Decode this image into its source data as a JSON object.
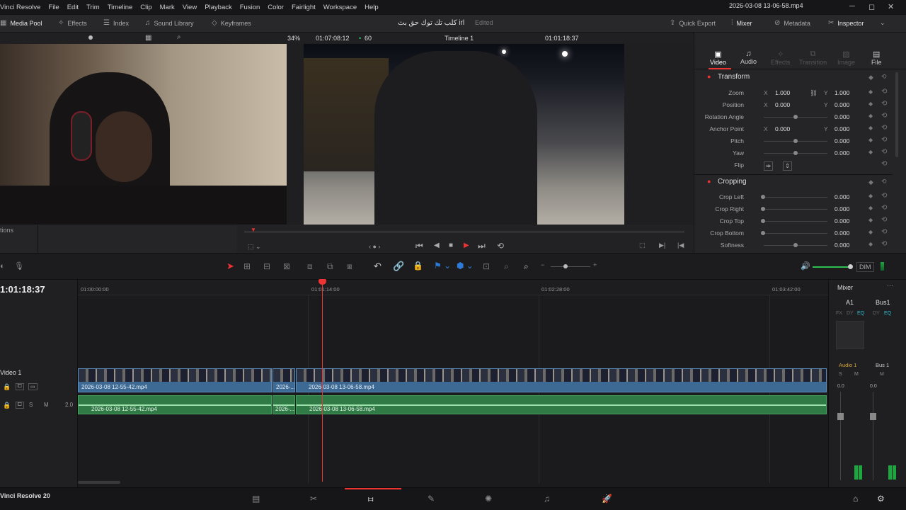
{
  "menu": {
    "app": "Vinci Resolve",
    "items": [
      "File",
      "Edit",
      "Trim",
      "Timeline",
      "Clip",
      "Mark",
      "View",
      "Playback",
      "Fusion",
      "Color",
      "Fairlight",
      "Workspace",
      "Help"
    ]
  },
  "toolbar": {
    "media_pool": "Media Pool",
    "effects": "Effects",
    "index": "Index",
    "sound_library": "Sound Library",
    "keyframes": "Keyframes",
    "project_title": "كلب تك توك حق بث irl",
    "edited": "Edited",
    "quick_export": "Quick Export",
    "mixer": "Mixer",
    "metadata": "Metadata",
    "inspector": "Inspector"
  },
  "viewer": {
    "zoom": "34%",
    "source_tc": "01:07:08:12",
    "fps": "60",
    "timeline_name": "Timeline 1",
    "record_tc": "01:01:18:37",
    "clip_name": "2026-03-08 13-06-58.mp4"
  },
  "left_panel": {
    "label": "tions"
  },
  "inspector": {
    "tabs": [
      "Video",
      "Audio",
      "Effects",
      "Transition",
      "Image",
      "File"
    ],
    "transform_title": "Transform",
    "cropping_title": "Cropping",
    "transform": [
      {
        "label": "Zoom",
        "x": "1.000",
        "y": "1.000"
      },
      {
        "label": "Position",
        "x": "0.000",
        "y": "0.000"
      },
      {
        "label": "Rotation Angle",
        "v": "0.000"
      },
      {
        "label": "Anchor Point",
        "x": "0.000",
        "y": "0.000"
      },
      {
        "label": "Pitch",
        "v": "0.000"
      },
      {
        "label": "Yaw",
        "v": "0.000"
      },
      {
        "label": "Flip"
      }
    ],
    "cropping": [
      {
        "label": "Crop Left",
        "v": "0.000"
      },
      {
        "label": "Crop Right",
        "v": "0.000"
      },
      {
        "label": "Crop Top",
        "v": "0.000"
      },
      {
        "label": "Crop Bottom",
        "v": "0.000"
      },
      {
        "label": "Softness",
        "v": "0.000"
      }
    ],
    "axis_x": "X",
    "axis_y": "Y"
  },
  "edit_toolbar": {
    "dim": "DIM"
  },
  "timeline": {
    "current_tc": "1:01:18:37",
    "ruler": [
      "01:00:00:00",
      "01:01:14:00",
      "01:02:28:00",
      "01:03:42:00"
    ],
    "video_track": "Video 1",
    "audio_level": "2.0",
    "clips_video": [
      "2026-03-08 12-55-42.mp4",
      "2026-...",
      "2026-03-08 13-06-58.mp4"
    ],
    "clips_audio": [
      "2026-03-08 12-55-42.mp4",
      "2026-...",
      "2026-03-08 13-06-58.mp4"
    ]
  },
  "mixer": {
    "title": "Mixer",
    "ch1": "A1",
    "ch2": "Bus1",
    "fx": "FX",
    "dy": "DY",
    "eq": "EQ",
    "audio1": "Audio 1",
    "bus1": "Bus 1",
    "s": "S",
    "m": "M",
    "lvl1": "0.0",
    "lvl2": "0.0"
  },
  "footer": {
    "app_version": "Vinci Resolve 20"
  }
}
